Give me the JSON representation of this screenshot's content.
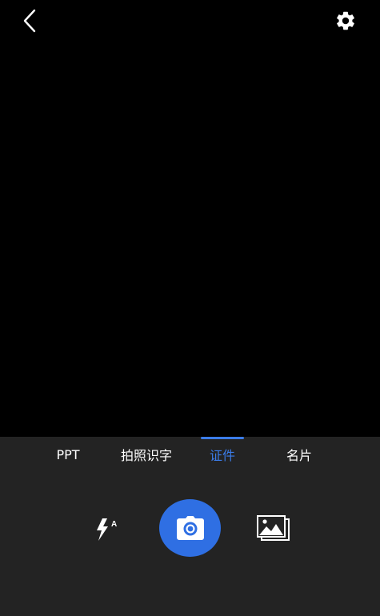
{
  "camera": {
    "modes": [
      "PPT",
      "拍照识字",
      "证件",
      "名片"
    ],
    "active_mode": "证件",
    "active_color": "#3b7ce8",
    "panel_color": "#232323",
    "shutter_color": "#2f6fe3"
  },
  "icons": {
    "back": "chevron-left-icon",
    "settings": "gear-icon",
    "flash": "flash-auto-icon",
    "shutter": "camera-icon",
    "gallery": "gallery-icon"
  },
  "flash": {
    "mode_letter": "A"
  }
}
